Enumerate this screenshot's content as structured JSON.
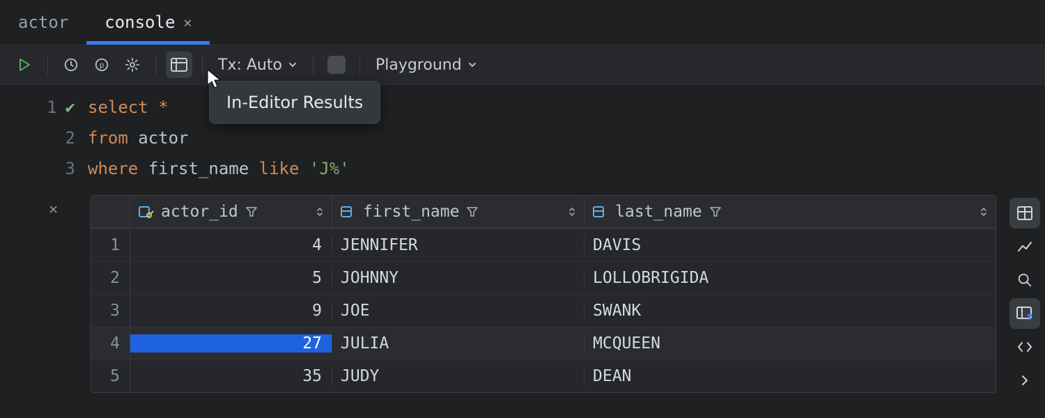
{
  "tabs": [
    {
      "label": "actor",
      "active": false,
      "closable": false
    },
    {
      "label": "console",
      "active": true,
      "closable": true
    }
  ],
  "toolbar": {
    "tx_label": "Tx: Auto",
    "playground_label": "Playground",
    "tooltip": "In-Editor Results"
  },
  "editor": {
    "lines": [
      {
        "n": "1",
        "ok": true,
        "tokens": [
          [
            "kw",
            "select"
          ],
          [
            "sp",
            " "
          ],
          [
            "star",
            "*"
          ]
        ]
      },
      {
        "n": "2",
        "ok": false,
        "tokens": [
          [
            "kw",
            "from"
          ],
          [
            "sp",
            " "
          ],
          [
            "ident",
            "actor"
          ]
        ]
      },
      {
        "n": "3",
        "ok": false,
        "tokens": [
          [
            "kw",
            "where"
          ],
          [
            "sp",
            " "
          ],
          [
            "ident",
            "first_name"
          ],
          [
            "sp",
            " "
          ],
          [
            "kw",
            "like"
          ],
          [
            "sp",
            " "
          ],
          [
            "str",
            "'J%'"
          ]
        ]
      }
    ]
  },
  "results": {
    "columns": [
      {
        "name": "actor_id",
        "icon": "key"
      },
      {
        "name": "first_name",
        "icon": "column"
      },
      {
        "name": "last_name",
        "icon": "column"
      }
    ],
    "rows": [
      {
        "idx": "1",
        "id": "4",
        "first": "JENNIFER",
        "last": "DAVIS",
        "selected": false
      },
      {
        "idx": "2",
        "id": "5",
        "first": "JOHNNY",
        "last": "LOLLOBRIGIDA",
        "selected": false
      },
      {
        "idx": "3",
        "id": "9",
        "first": "JOE",
        "last": "SWANK",
        "selected": false
      },
      {
        "idx": "4",
        "id": "27",
        "first": "JULIA",
        "last": "MCQUEEN",
        "selected": true
      },
      {
        "idx": "5",
        "id": "35",
        "first": "JUDY",
        "last": "DEAN",
        "selected": false
      }
    ]
  }
}
